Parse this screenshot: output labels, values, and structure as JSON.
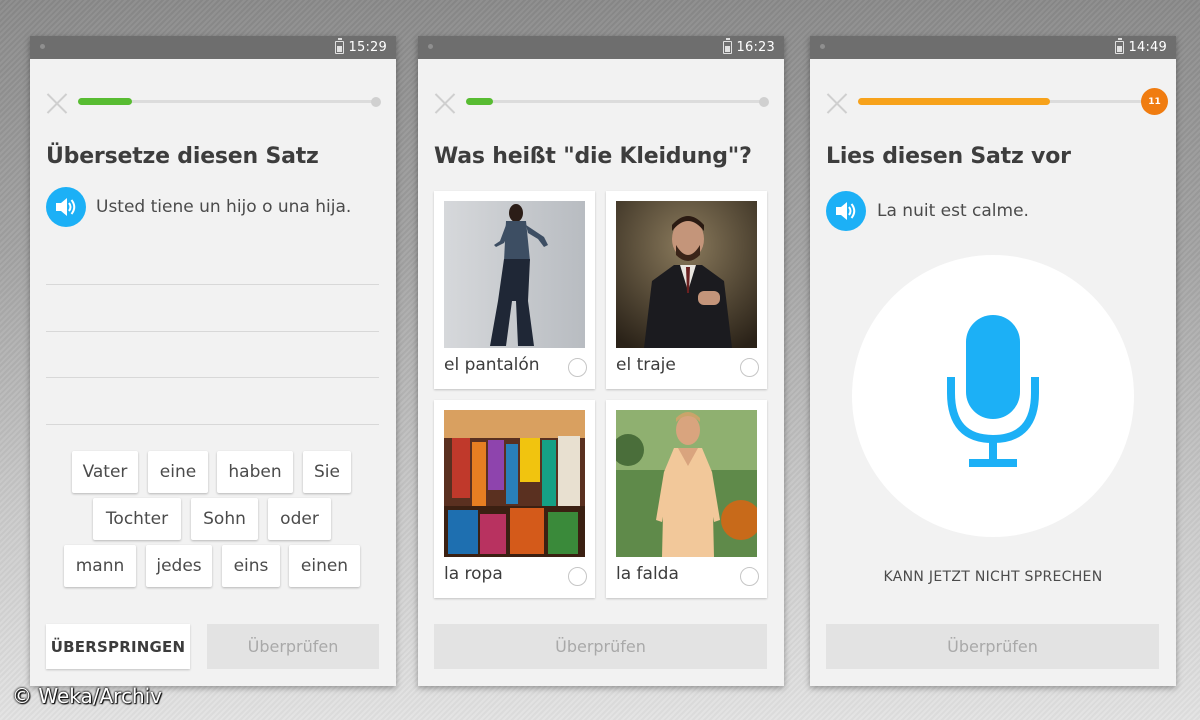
{
  "phone1": {
    "time": "15:29",
    "progress": 0.18,
    "progress_color": "#58bc32",
    "title": "Übersetze diesen Satz",
    "sentence": "Usted tiene un hijo o una hija.",
    "word_bank": [
      [
        "Vater",
        "eine",
        "haben",
        "Sie"
      ],
      [
        "Tochter",
        "Sohn",
        "oder"
      ],
      [
        "mann",
        "jedes",
        "eins",
        "einen"
      ]
    ],
    "skip_label": "ÜBERSPRINGEN",
    "check_label": "Überprüfen"
  },
  "phone2": {
    "time": "16:23",
    "progress": 0.09,
    "progress_color": "#58bc32",
    "title": "Was heißt \"die Kleidung\"?",
    "options": [
      "el pantalón",
      "el traje",
      "la ropa",
      "la falda"
    ],
    "check_label": "Überprüfen"
  },
  "phone3": {
    "time": "14:49",
    "progress": 0.67,
    "progress_color": "#f7a21b",
    "streak_count": "11",
    "title": "Lies diesen Satz vor",
    "sentence": "La nuit est calme.",
    "cant_speak_label": "KANN JETZT NICHT SPRECHEN",
    "check_label": "Überprüfen"
  },
  "watermark": "© Weka/Archiv"
}
